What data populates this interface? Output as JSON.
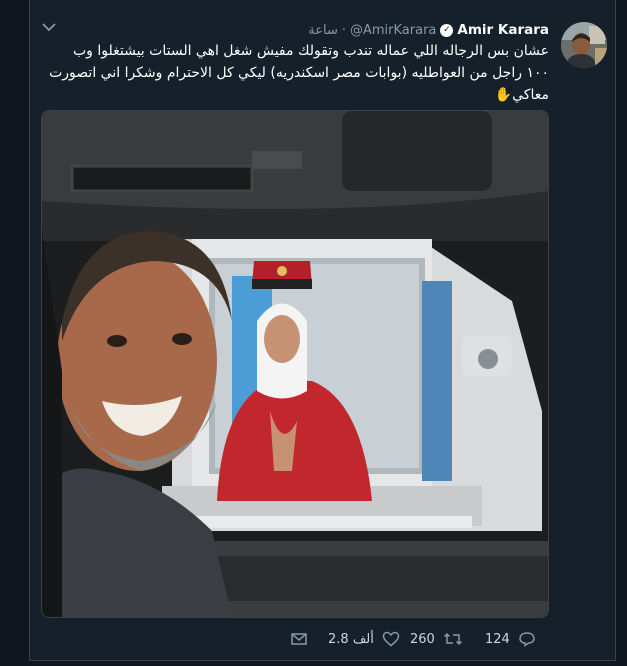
{
  "tweet": {
    "display_name": "Amir Karara",
    "handle": "@AmirKarara",
    "separator": "·",
    "time": "ساعة",
    "text_line1": "عشان بس الرجاله اللي عماله تندب  وتقولك مفيش شغل اهي الستات بيشتغلوا وب",
    "text_line2": "١٠٠ راجل من العواطليه (بوابات مصر اسكندريه) ليكي كل الاحترام وشكرا اني اتصورت",
    "text_line3": "معاكي",
    "emoji": "✋"
  },
  "actions": {
    "replies": "124",
    "retweets": "260",
    "likes": "2.8 ألف"
  },
  "icons": {
    "reply": "reply-icon",
    "retweet": "retweet-icon",
    "like": "heart-icon",
    "message": "envelope-icon",
    "verified": "verified-badge-icon",
    "menu": "chevron-down-icon"
  },
  "colors": {
    "background": "#15202b",
    "page": "#10171e",
    "muted": "#8899a6",
    "border": "#38444d"
  }
}
